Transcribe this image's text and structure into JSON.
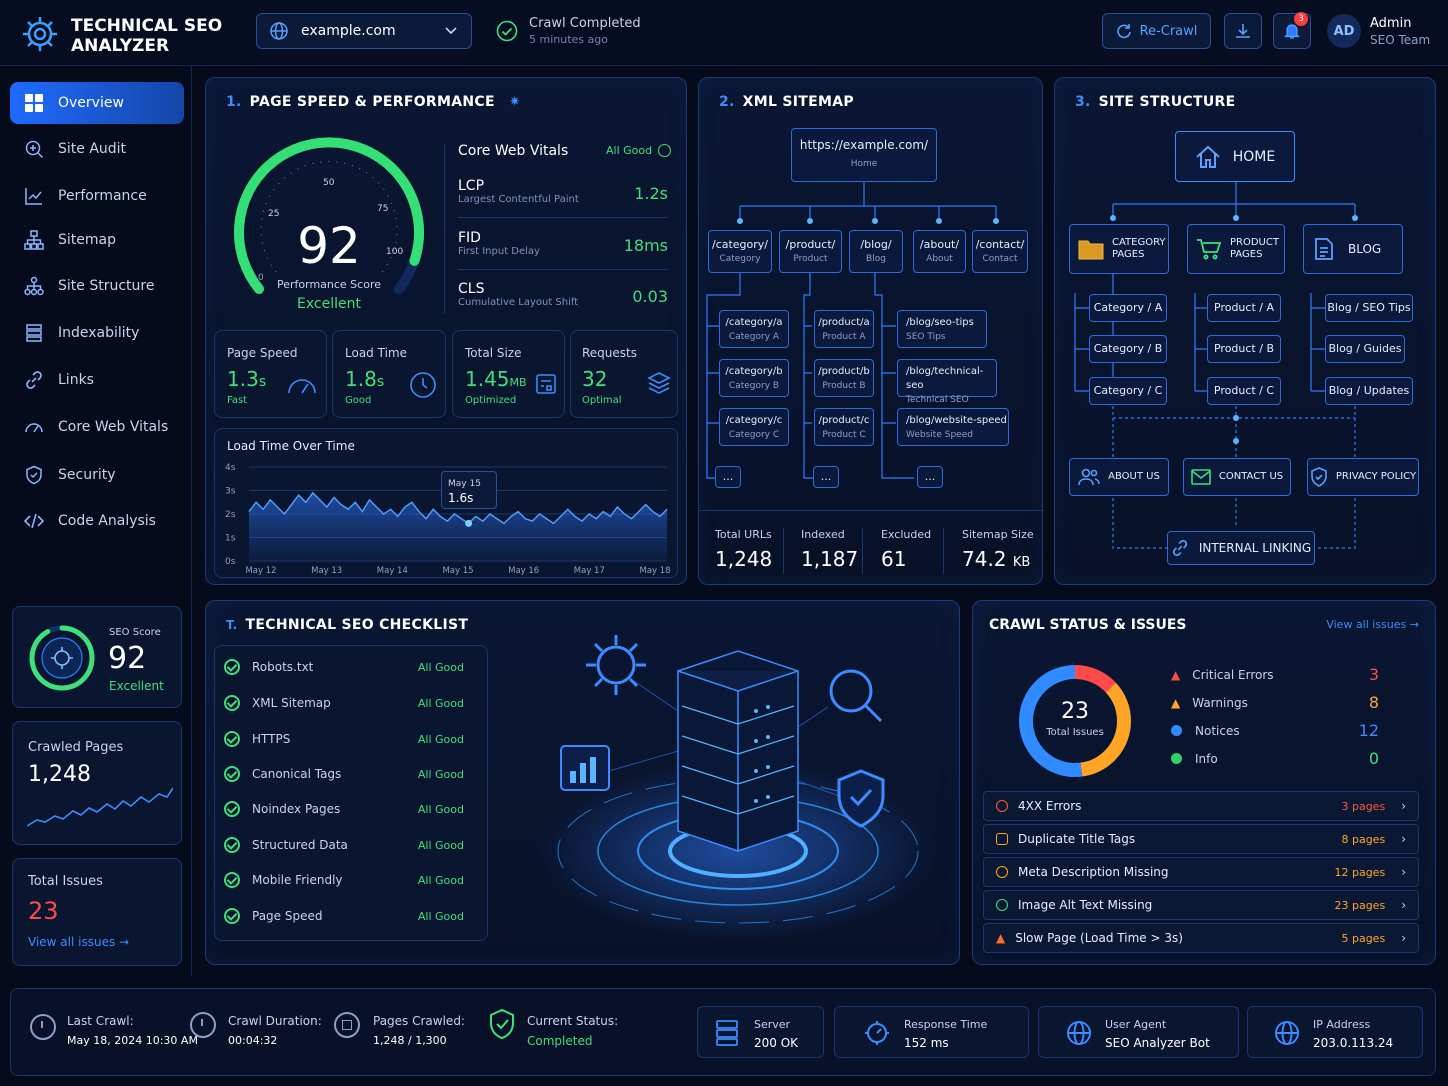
{
  "app": {
    "title_line1": "TECHNICAL SEO",
    "title_line2": "ANALYZER"
  },
  "header": {
    "domain": "example.com",
    "crawl_status": "Crawl Completed",
    "crawl_time": "5 minutes ago",
    "recrawl_label": "Re-Crawl",
    "notif_count": "3",
    "user_initials": "AD",
    "user_name": "Admin",
    "user_role": "SEO Team"
  },
  "sidebar": {
    "items": [
      {
        "label": "Overview"
      },
      {
        "label": "Site Audit"
      },
      {
        "label": "Performance"
      },
      {
        "label": "Sitemap"
      },
      {
        "label": "Site Structure"
      },
      {
        "label": "Indexability"
      },
      {
        "label": "Links"
      },
      {
        "label": "Core Web Vitals"
      },
      {
        "label": "Security"
      },
      {
        "label": "Code Analysis"
      }
    ],
    "seo_score": {
      "label": "SEO Score",
      "value": "92",
      "rating": "Excellent"
    },
    "crawled": {
      "label": "Crawled Pages",
      "value": "1,248"
    },
    "issues": {
      "label": "Total Issues",
      "value": "23",
      "link": "View all issues →"
    }
  },
  "speed": {
    "num": "1.",
    "title": "PAGE SPEED & PERFORMANCE",
    "score": "92",
    "score_fraction": 0.92,
    "score_label": "Performance Score",
    "score_rating": "Excellent",
    "gauge_ticks": [
      "0",
      "25",
      "50",
      "75",
      "100"
    ],
    "cwv_title": "Core Web Vitals",
    "cwv_status": "All Good",
    "vitals": [
      {
        "name": "LCP",
        "desc": "Largest Contentful Paint",
        "value": "1.2s"
      },
      {
        "name": "FID",
        "desc": "First Input Delay",
        "value": "18ms"
      },
      {
        "name": "CLS",
        "desc": "Cumulative Layout Shift",
        "value": "0.03"
      }
    ],
    "stats": [
      {
        "label": "Page Speed",
        "value": "1.3",
        "unit": "s",
        "note": "Fast"
      },
      {
        "label": "Load Time",
        "value": "1.8",
        "unit": "s",
        "note": "Good"
      },
      {
        "label": "Total Size",
        "value": "1.45",
        "unit": "MB",
        "note": "Optimized"
      },
      {
        "label": "Requests",
        "value": "32",
        "unit": "",
        "note": "Optimal"
      }
    ],
    "chart_title": "Load Time Over Time",
    "tooltip_date": "May 15",
    "tooltip_value": "1.6s"
  },
  "chart_data": {
    "type": "area",
    "title": "Load Time Over Time",
    "x": [
      "May 12",
      "May 13",
      "May 14",
      "May 15",
      "May 16",
      "May 17",
      "May 18"
    ],
    "y_ticks": [
      "0s",
      "1s",
      "2s",
      "3s",
      "4s"
    ],
    "ylim": [
      0,
      4
    ],
    "series": [
      {
        "values": [
          2.1,
          2.5,
          2.2,
          2.6,
          2.3,
          2.0,
          2.4,
          2.8,
          2.5,
          2.9,
          2.6,
          2.3,
          2.7,
          2.4,
          2.2,
          2.5,
          2.1,
          2.6,
          2.3,
          2.0,
          2.2,
          1.9,
          2.3,
          2.5,
          2.1,
          1.8,
          2.2,
          1.9,
          1.7,
          2.0,
          1.8,
          1.6,
          1.9,
          1.7,
          2.0,
          1.8,
          1.6,
          1.9,
          2.1,
          1.8,
          1.7,
          2.0,
          1.8,
          1.6,
          1.9,
          2.2,
          1.9,
          1.7,
          2.0,
          1.8,
          2.1,
          1.9,
          2.3,
          2.0,
          1.8,
          2.1,
          2.4,
          2.1,
          1.9,
          2.2
        ]
      }
    ]
  },
  "sitemap": {
    "num": "2.",
    "title": "XML SITEMAP",
    "root_url": "https://example.com/",
    "root_label": "Home",
    "sections": [
      {
        "path": "/category/",
        "label": "Category"
      },
      {
        "path": "/product/",
        "label": "Product"
      },
      {
        "path": "/blog/",
        "label": "Blog"
      },
      {
        "path": "/about/",
        "label": "About"
      },
      {
        "path": "/contact/",
        "label": "Contact"
      }
    ],
    "cat_children": [
      {
        "path": "/category/a",
        "label": "Category A"
      },
      {
        "path": "/category/b",
        "label": "Category B"
      },
      {
        "path": "/category/c",
        "label": "Category C"
      }
    ],
    "prod_children": [
      {
        "path": "/product/a",
        "label": "Product A"
      },
      {
        "path": "/product/b",
        "label": "Product B"
      },
      {
        "path": "/product/c",
        "label": "Product C"
      }
    ],
    "blog_children": [
      {
        "path": "/blog/seo-tips",
        "label": "SEO Tips"
      },
      {
        "path": "/blog/technical-seo",
        "label": "Technical SEO"
      },
      {
        "path": "/blog/website-speed",
        "label": "Website Speed"
      }
    ],
    "more": "...",
    "stats": [
      {
        "label": "Total URLs",
        "value": "1,248",
        "unit": ""
      },
      {
        "label": "Indexed",
        "value": "1,187",
        "unit": ""
      },
      {
        "label": "Excluded",
        "value": "61",
        "unit": ""
      },
      {
        "label": "Sitemap Size",
        "value": "74.2",
        "unit": "KB"
      }
    ]
  },
  "structure": {
    "num": "3.",
    "title": "SITE STRUCTURE",
    "home": "HOME",
    "groups": [
      {
        "title_l1": "CATEGORY",
        "title_l2": "PAGES",
        "items": [
          "Category / A",
          "Category / B",
          "Category / C"
        ]
      },
      {
        "title_l1": "PRODUCT",
        "title_l2": "PAGES",
        "items": [
          "Product / A",
          "Product / B",
          "Product / C"
        ]
      },
      {
        "title_l1": "BLOG",
        "title_l2": "",
        "items": [
          "Blog / SEO Tips",
          "Blog / Guides",
          "Blog / Updates"
        ]
      }
    ],
    "bottom": [
      "ABOUT US",
      "CONTACT US",
      "PRIVACY POLICY"
    ],
    "internal": "INTERNAL LINKING"
  },
  "checklist": {
    "num": "T.",
    "title": "TECHNICAL SEO CHECKLIST",
    "items": [
      {
        "label": "Robots.txt",
        "status": "All Good"
      },
      {
        "label": "XML Sitemap",
        "status": "All Good"
      },
      {
        "label": "HTTPS",
        "status": "All Good"
      },
      {
        "label": "Canonical Tags",
        "status": "All Good"
      },
      {
        "label": "Noindex Pages",
        "status": "All Good"
      },
      {
        "label": "Structured Data",
        "status": "All Good"
      },
      {
        "label": "Mobile Friendly",
        "status": "All Good"
      },
      {
        "label": "Page Speed",
        "status": "All Good"
      }
    ]
  },
  "crawl": {
    "title": "CRAWL STATUS & ISSUES",
    "view_all": "View all issues →",
    "total": "23",
    "total_label": "Total Issues",
    "legend": [
      {
        "label": "Critical Errors",
        "value": "3",
        "color": "#ff4a4a"
      },
      {
        "label": "Warnings",
        "value": "8",
        "color": "#ffa526"
      },
      {
        "label": "Notices",
        "value": "12",
        "color": "#2f8bff"
      },
      {
        "label": "Info",
        "value": "0",
        "color": "#2fd36a"
      }
    ],
    "issues": [
      {
        "label": "4XX Errors",
        "pages": "3 pages",
        "color": "#ff5a3a"
      },
      {
        "label": "Duplicate Title Tags",
        "pages": "8 pages",
        "color": "#ffa526"
      },
      {
        "label": "Meta Description Missing",
        "pages": "12 pages",
        "color": "#ffa526"
      },
      {
        "label": "Image Alt Text Missing",
        "pages": "23 pages",
        "color": "#3fe07a"
      },
      {
        "label": "Slow Page (Load Time > 3s)",
        "pages": "5 pages",
        "color": "#ff6a2a"
      }
    ]
  },
  "footer": {
    "last_crawl_label": "Last Crawl:",
    "last_crawl": "May 18, 2024  10:30 AM",
    "duration_label": "Crawl Duration:",
    "duration": "00:04:32",
    "pages_label": "Pages Crawled:",
    "pages": "1,248  /  1,300",
    "status_label": "Current Status:",
    "status": "Completed",
    "server_label": "Server",
    "server": "200 OK",
    "response_label": "Response Time",
    "response": "152 ms",
    "agent_label": "User Agent",
    "agent": "SEO Analyzer Bot",
    "ip_label": "IP Address",
    "ip": "203.0.113.24"
  }
}
